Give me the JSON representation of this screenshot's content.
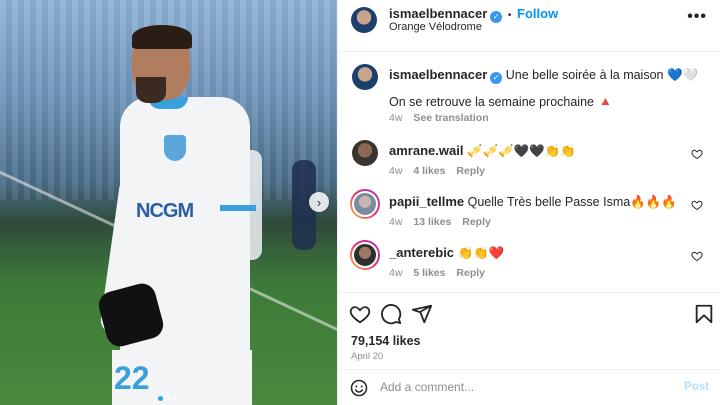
{
  "post": {
    "author": "ismaelbennacer",
    "follow_label": "Follow",
    "separator": "•",
    "location": "Orange Vélodrome",
    "more_label": "•••",
    "sponsor_text": "NCGM",
    "jersey_number": "22"
  },
  "caption": {
    "username": "ismaelbennacer",
    "text_line1": "Une belle soirée à la maison 💙🤍",
    "text_line2": "On se retrouve la semaine prochaine 🔺",
    "time": "4w",
    "see_translation": "See translation"
  },
  "comments": [
    {
      "username": "amrane.wail",
      "text": "🎺🎺🎺🖤🖤👏👏",
      "time": "4w",
      "likes": "4 likes",
      "reply": "Reply"
    },
    {
      "username": "papii_tellme",
      "text": "Quelle Très belle Passe Isma🔥🔥🔥",
      "time": "4w",
      "likes": "13 likes",
      "reply": "Reply"
    },
    {
      "username": "_anterebic",
      "text": "👏👏❤️",
      "time": "4w",
      "likes": "5 likes",
      "reply": "Reply"
    }
  ],
  "footer": {
    "likes": "79,154 likes",
    "date": "April 20",
    "comment_placeholder": "Add a comment...",
    "post_label": "Post"
  },
  "colors": {
    "accent": "#0095f6",
    "verified": "#3897f0",
    "muted": "#8e8e8e"
  },
  "icons": [
    "heart-icon",
    "comment-icon",
    "share-icon",
    "bookmark-icon",
    "emoji-icon",
    "chevron-right-icon",
    "verified-icon"
  ]
}
